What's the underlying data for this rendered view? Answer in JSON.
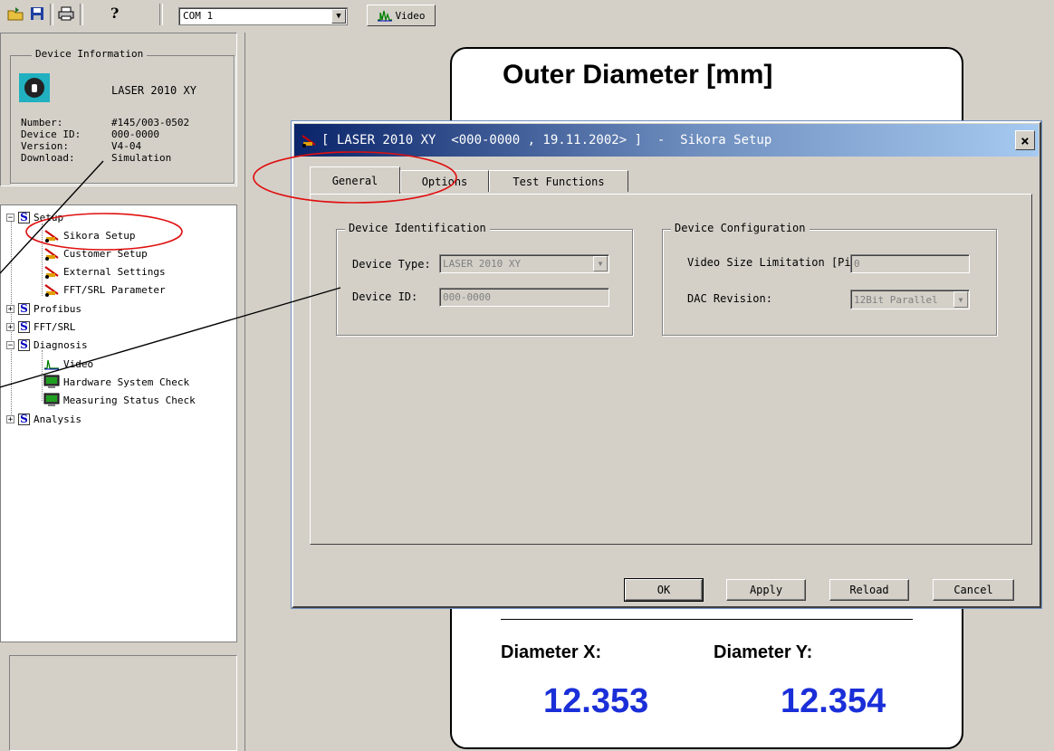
{
  "toolbar": {
    "port": "COM 1",
    "video_label": "Video"
  },
  "device_info": {
    "title": "Device Information",
    "name": "LASER 2010 XY",
    "fields": [
      {
        "key": "Number:",
        "value": "#145/003-0502"
      },
      {
        "key": "Device ID:",
        "value": "000-0000"
      },
      {
        "key": "Version:",
        "value": "V4-04"
      },
      {
        "key": "Download:",
        "value": "Simulation"
      }
    ]
  },
  "tree": {
    "setup": "Setup",
    "sikora_setup": "Sikora Setup",
    "customer_setup": "Customer Setup",
    "external_settings": "External Settings",
    "fft_srl_parameter": "FFT/SRL Parameter",
    "profibus": "Profibus",
    "fft_srl": "FFT/SRL",
    "diagnosis": "Diagnosis",
    "video": "Video",
    "hardware_check": "Hardware System Check",
    "measuring_check": "Measuring Status Check",
    "analysis": "Analysis",
    "s_glyph": "S"
  },
  "display": {
    "title": "Outer Diameter  [mm]",
    "label_x": "Diameter X:",
    "label_y": "Diameter Y:",
    "value_x": "12.353",
    "value_y": "12.354"
  },
  "dialog": {
    "title": "[ LASER 2010 XY  <000-0000 , 19.11.2002> ]  -  Sikora Setup",
    "close": "×",
    "tabs": [
      "General",
      "Options",
      "Test Functions"
    ],
    "identification": {
      "title": "Device Identification",
      "device_type_label": "Device Type:",
      "device_type_value": "LASER 2010 XY",
      "device_id_label": "Device ID:",
      "device_id_value": "000-0000"
    },
    "configuration": {
      "title": "Device Configuration",
      "video_label": "Video Size Limitation [Pixel]:",
      "video_value": "0",
      "dac_label": "DAC  Revision:",
      "dac_value": "12Bit Parallel"
    },
    "buttons": {
      "ok": "OK",
      "apply": "Apply",
      "reload": "Reload",
      "cancel": "Cancel"
    }
  },
  "colors": {
    "window_bg": "#d4d0c8",
    "title_gradient_start": "#0a246a",
    "value_blue": "#1a2fd8",
    "annotation_red": "#e01010"
  }
}
